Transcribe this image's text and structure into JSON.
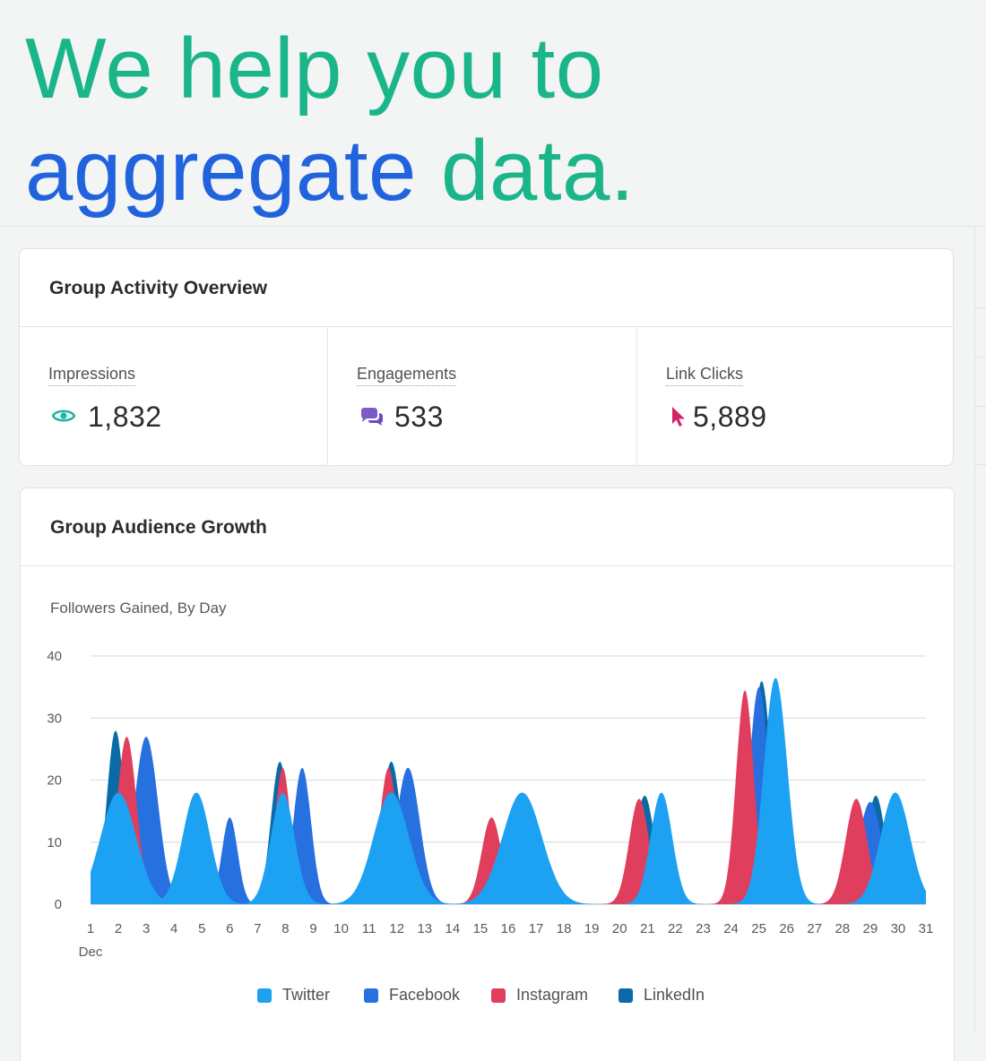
{
  "hero": {
    "line1": "We help you to",
    "line2_highlight": "aggregate",
    "line2_rest": "data."
  },
  "overview": {
    "title": "Group Activity Overview",
    "metrics": [
      {
        "label": "Impressions",
        "value": "1,832",
        "icon": "eye-icon",
        "color": "#1fb5a8"
      },
      {
        "label": "Engagements",
        "value": "533",
        "icon": "chat-bubbles-icon",
        "color": "#7a5bc8"
      },
      {
        "label": "Link Clicks",
        "value": "5,889",
        "icon": "cursor-icon",
        "color": "#d3246a"
      }
    ]
  },
  "growth": {
    "title": "Group Audience Growth",
    "subtitle": "Followers Gained, By Day"
  },
  "chart_data": {
    "type": "area",
    "title": "Followers Gained, By Day",
    "x": [
      1,
      2,
      3,
      4,
      5,
      6,
      7,
      8,
      9,
      10,
      11,
      12,
      13,
      14,
      15,
      16,
      17,
      18,
      19,
      20,
      21,
      22,
      23,
      24,
      25,
      26,
      27,
      28,
      29,
      30,
      31
    ],
    "x_tick_labels": [
      "1",
      "2",
      "3",
      "4",
      "5",
      "6",
      "7",
      "8",
      "9",
      "10",
      "11",
      "12",
      "13",
      "14",
      "15",
      "16",
      "17",
      "18",
      "19",
      "20",
      "21",
      "22",
      "23",
      "24",
      "25",
      "26",
      "27",
      "28",
      "29",
      "30",
      "31"
    ],
    "x_sublabel": "Dec",
    "ylim": [
      0,
      40
    ],
    "y_ticks": [
      0,
      10,
      20,
      30,
      40
    ],
    "grid": true,
    "legend_position": "bottom",
    "series": [
      {
        "name": "LinkedIn",
        "color": "#0a6aa8",
        "peaks": [
          [
            1.9,
            28,
            0.45
          ],
          [
            7.8,
            23,
            0.45
          ],
          [
            11.8,
            23,
            0.5
          ],
          [
            20.9,
            17.5,
            0.5
          ],
          [
            25.1,
            36,
            0.5
          ],
          [
            29.2,
            17.5,
            0.5
          ]
        ]
      },
      {
        "name": "Facebook",
        "color": "#2770e0",
        "peaks": [
          [
            3.0,
            27,
            0.6
          ],
          [
            6.0,
            14,
            0.4
          ],
          [
            8.6,
            22,
            0.45
          ],
          [
            12.4,
            22,
            0.6
          ],
          [
            25.0,
            35,
            0.5
          ],
          [
            29.0,
            16.5,
            0.6
          ]
        ]
      },
      {
        "name": "Instagram",
        "color": "#e03e5d",
        "peaks": [
          [
            2.3,
            27,
            0.5
          ],
          [
            7.9,
            22,
            0.4
          ],
          [
            11.7,
            22,
            0.45
          ],
          [
            15.4,
            14,
            0.5
          ],
          [
            20.7,
            17,
            0.5
          ],
          [
            24.5,
            34.5,
            0.45
          ],
          [
            28.5,
            17,
            0.55
          ]
        ]
      },
      {
        "name": "Twitter",
        "color": "#1da1f2",
        "peaks": [
          [
            2.0,
            18,
            0.9
          ],
          [
            4.8,
            18,
            0.7
          ],
          [
            7.9,
            18,
            0.6
          ],
          [
            11.8,
            18,
            0.9
          ],
          [
            16.5,
            18,
            1.0
          ],
          [
            21.5,
            18,
            0.55
          ],
          [
            25.6,
            36.5,
            0.6
          ],
          [
            29.9,
            18,
            0.75
          ]
        ]
      }
    ],
    "legend": [
      {
        "name": "Twitter",
        "color": "#1da1f2"
      },
      {
        "name": "Facebook",
        "color": "#2770e0"
      },
      {
        "name": "Instagram",
        "color": "#e03e5d"
      },
      {
        "name": "LinkedIn",
        "color": "#0a6aa8"
      }
    ]
  }
}
